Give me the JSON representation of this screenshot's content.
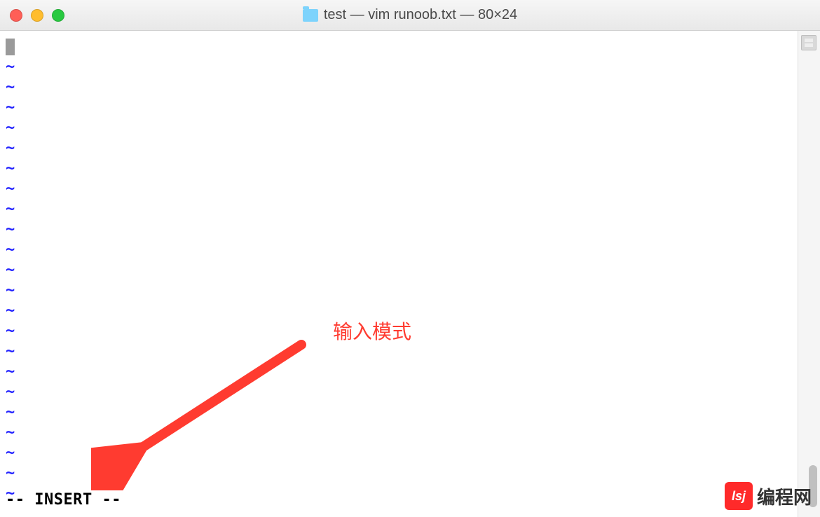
{
  "titlebar": {
    "title": "test — vim runoob.txt — 80×24"
  },
  "editor": {
    "tilde": "~",
    "tilde_count": 22,
    "status": "-- INSERT --"
  },
  "annotation": {
    "label": "输入模式"
  },
  "watermark": {
    "logo_text": "lsj",
    "text": "编程网"
  },
  "colors": {
    "tilde": "#2424ff",
    "annotation": "#ff3b30",
    "watermark_bg": "#ff2a2a"
  }
}
